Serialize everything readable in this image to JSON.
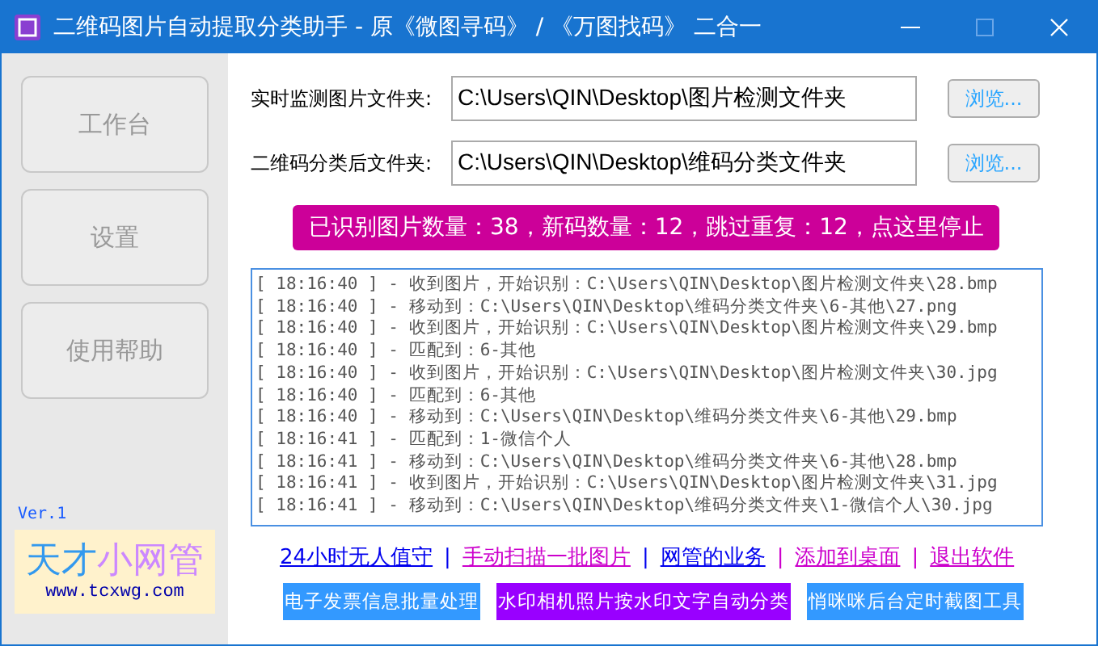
{
  "window": {
    "title": "二维码图片自动提取分类助手 - 原《微图寻码》 / 《万图找码》 二合一"
  },
  "sidebar": {
    "items": [
      {
        "label": "工作台"
      },
      {
        "label": "设置"
      },
      {
        "label": "使用帮助"
      }
    ],
    "version": "Ver.1",
    "logo": {
      "name_part_1": "天才",
      "name_part_2": "小网管",
      "url": "www.tcxwg.com"
    }
  },
  "folders": [
    {
      "label": "实时监测图片文件夹:",
      "value": "C:\\Users\\QIN\\Desktop\\图片检测文件夹",
      "button": "浏览..."
    },
    {
      "label": "二维码分类后文件夹:",
      "value": "C:\\Users\\QIN\\Desktop\\维码分类文件夹",
      "button": "浏览..."
    }
  ],
  "status_button": "已识别图片数量：38，新码数量：12，跳过重复：12，点这里停止",
  "log": [
    "[ 18:16:40 ] - 收到图片，开始识别：C:\\Users\\QIN\\Desktop\\图片检测文件夹\\28.bmp",
    "[ 18:16:40 ] - 移动到：C:\\Users\\QIN\\Desktop\\维码分类文件夹\\6-其他\\27.png",
    "[ 18:16:40 ] - 收到图片，开始识别：C:\\Users\\QIN\\Desktop\\图片检测文件夹\\29.bmp",
    "[ 18:16:40 ] - 匹配到：6-其他",
    "[ 18:16:40 ] - 收到图片，开始识别：C:\\Users\\QIN\\Desktop\\图片检测文件夹\\30.jpg",
    "[ 18:16:40 ] - 匹配到：6-其他",
    "[ 18:16:40 ] - 移动到：C:\\Users\\QIN\\Desktop\\维码分类文件夹\\6-其他\\29.bmp",
    "[ 18:16:41 ] - 匹配到：1-微信个人",
    "[ 18:16:41 ] - 移动到：C:\\Users\\QIN\\Desktop\\维码分类文件夹\\6-其他\\28.bmp",
    "[ 18:16:41 ] - 收到图片，开始识别：C:\\Users\\QIN\\Desktop\\图片检测文件夹\\31.jpg",
    "[ 18:16:41 ] - 移动到：C:\\Users\\QIN\\Desktop\\维码分类文件夹\\1-微信个人\\30.jpg"
  ],
  "links": [
    {
      "kind": "link",
      "label": "24小时无人值守",
      "color": "#0000ee"
    },
    {
      "kind": "separator",
      "label": "|",
      "color": "#0000ee"
    },
    {
      "kind": "link",
      "label": "手动扫描一批图片",
      "color": "#cc00cc"
    },
    {
      "kind": "separator",
      "label": "|",
      "color": "#0000ee"
    },
    {
      "kind": "link",
      "label": "网管的业务",
      "color": "#0000ee"
    },
    {
      "kind": "separator",
      "label": "|",
      "color": "#cc00cc"
    },
    {
      "kind": "link",
      "label": "添加到桌面",
      "color": "#cc00cc"
    },
    {
      "kind": "separator",
      "label": "|",
      "color": "#cc00cc"
    },
    {
      "kind": "link",
      "label": "退出软件",
      "color": "#cc00cc"
    }
  ],
  "tools": [
    {
      "label": "电子发票信息批量处理",
      "color": "#3399ff"
    },
    {
      "label": "水印相机照片按水印文字自动分类",
      "color": "#9900ff"
    },
    {
      "label": "悄咪咪后台定时截图工具",
      "color": "#3399ff"
    }
  ]
}
